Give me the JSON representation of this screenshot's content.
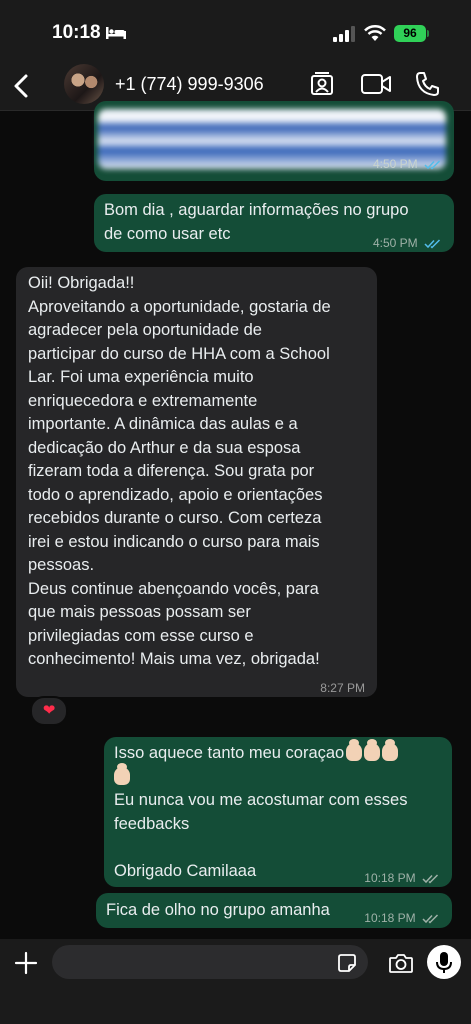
{
  "status_bar": {
    "time": "10:18",
    "battery": "96"
  },
  "header": {
    "contact_name": "+1 (774) 999-9306"
  },
  "messages": {
    "image_msg": {
      "time": "4:50 PM"
    },
    "msg1": {
      "lines": [
        "Bom dia , aguardar informações no grupo",
        "de como usar etc"
      ],
      "time": "4:50 PM"
    },
    "msg2": {
      "lines": [
        "Oii! Obrigada!!",
        "Aproveitando a oportunidade, gostaria de",
        "agradecer pela oportunidade de",
        "participar do curso de HHA com a School",
        "Lar. Foi uma experiência muito",
        "enriquecedora e extremamente",
        "importante. A dinâmica das aulas e a",
        "dedicação do Arthur e da sua esposa",
        "fizeram toda a diferença. Sou grata por",
        "todo o aprendizado, apoio e orientações",
        "recebidos durante o curso. Com certeza",
        "irei e estou indicando o curso para mais",
        "pessoas.",
        "Deus continue abençoando vocês, para",
        "que mais pessoas possam ser",
        "privilegiadas com esse curso e",
        "conhecimento! Mais uma vez, obrigada!"
      ],
      "time": "8:27 PM",
      "reaction": "❤"
    },
    "msg3": {
      "line1": "Isso aquece tanto meu coraçao",
      "lines": [
        "Eu nunca vou me acostumar com esses",
        "feedbacks",
        "",
        "Obrigado Camilaaa"
      ],
      "time": "10:18 PM"
    },
    "msg4": {
      "text": "Fica de olho no grupo amanha",
      "time": "10:18 PM"
    }
  },
  "colors": {
    "outgoing": "#144d37",
    "incoming": "#262628",
    "read_tick": "#53bdeb"
  }
}
